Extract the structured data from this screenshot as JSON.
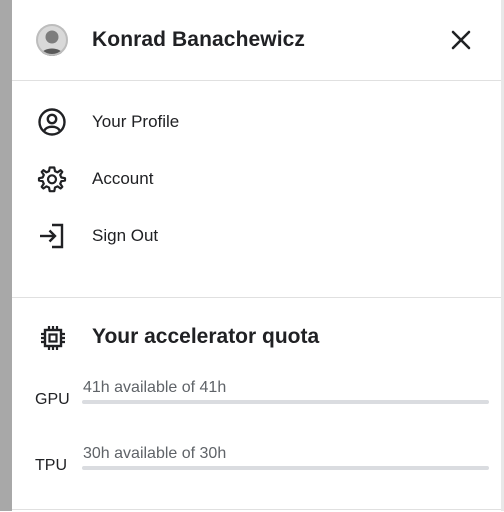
{
  "header": {
    "user_name": "Konrad Banachewicz",
    "close_icon": "close-icon"
  },
  "menu": {
    "items": [
      {
        "label": "Your Profile",
        "icon": "user-circle-icon"
      },
      {
        "label": "Account",
        "icon": "gear-icon"
      },
      {
        "label": "Sign Out",
        "icon": "sign-out-icon"
      }
    ]
  },
  "quota": {
    "title": "Your accelerator quota",
    "icon": "chip-icon",
    "rows": [
      {
        "name": "GPU",
        "text": "41h available of 41h",
        "fraction_used": 0
      },
      {
        "name": "TPU",
        "text": "30h available of 30h",
        "fraction_used": 0
      }
    ]
  },
  "colors": {
    "text": "#202124",
    "muted": "#5f6368",
    "divider": "#e0e0e0",
    "bar_track": "#dadce0"
  }
}
